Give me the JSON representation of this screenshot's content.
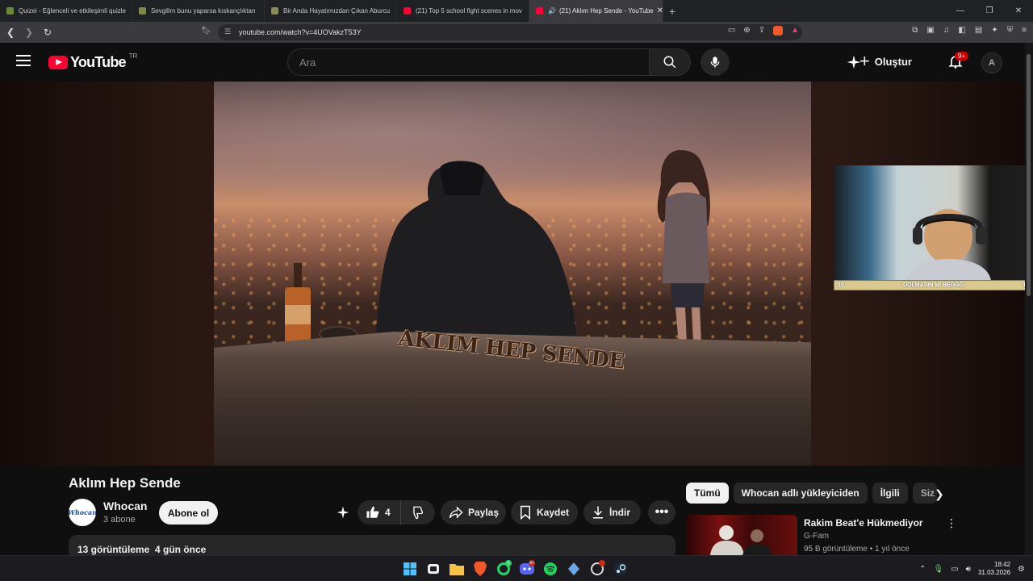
{
  "browser": {
    "tabs": [
      {
        "title": "Quizei - Eğlenceli ve etkileşimli quizle",
        "color": "#6a8a3a"
      },
      {
        "title": "Sevgilim bunu yaparsa kıskançlıktan",
        "color": "#7a8a4a"
      },
      {
        "title": "Bir Anda Hayatımızdan Çıkan Aburcu",
        "color": "#8a8a5a"
      },
      {
        "title": "(21) Top 5 school fight scenes in mov",
        "color": "#ff0033"
      },
      {
        "title": "(21) Aklım Hep Sende - YouTube",
        "color": "#ff0033"
      }
    ],
    "active_tab_speaker": "🔊",
    "url": "youtube.com/watch?v=4UOVakzT53Y"
  },
  "youtube": {
    "logo_text": "YouTube",
    "country_code": "TR",
    "search_placeholder": "Ara",
    "create_label": "Oluştur",
    "notifications_badge": "9+",
    "avatar_initial": "A"
  },
  "video": {
    "overlay_text": "AKLIM HEP SENDE",
    "title": "Aklım Hep Sende"
  },
  "webcam": {
    "bar_left": "10",
    "bar_text": "DOLMASIN MI BEGGĞ",
    "bar_right": "10"
  },
  "channel": {
    "logo_text": "Whocan",
    "name": "Whocan",
    "subscribers": "3 abone",
    "subscribe_label": "Abone ol"
  },
  "actions": {
    "like_count": "4",
    "share_label": "Paylaş",
    "save_label": "Kaydet",
    "download_label": "İndir"
  },
  "description": {
    "stats": "13 görüntüleme  4 gün önce"
  },
  "chips": [
    "Tümü",
    "Whocan adlı yükleyiciden",
    "İlgili",
    "Siz"
  ],
  "recommended": {
    "title": "Rakim Beat'e Hükmediyor",
    "channel": "G-Fam",
    "meta": "95 B görüntüleme • 1 yıl önce"
  },
  "taskbar": {
    "time": "18:42",
    "date": "31.03.2026"
  },
  "colors": {
    "youtube_red": "#ff0033",
    "background": "#0f0f0f",
    "pill_gray": "#272727"
  }
}
